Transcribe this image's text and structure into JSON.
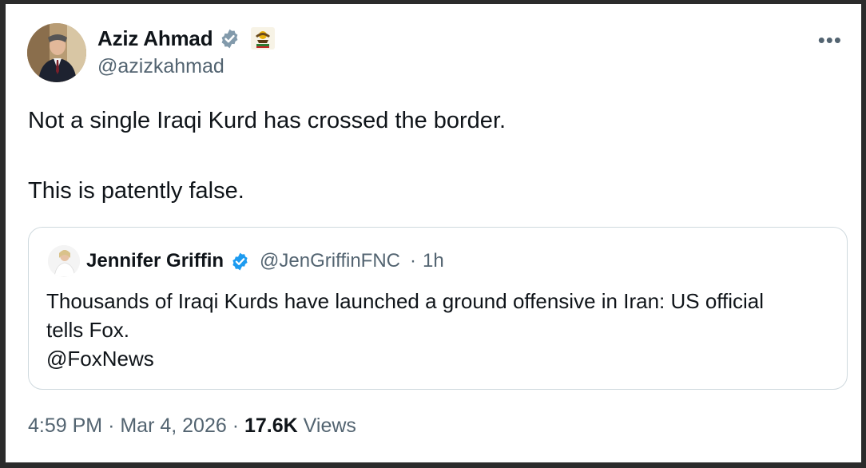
{
  "author": {
    "display_name": "Aziz Ahmad",
    "handle": "@azizkahmad",
    "verified_icon": "verified-badge-icon",
    "flag_icon": "kurdistan-emblem-icon"
  },
  "tweet": {
    "line1": "Not a single Iraqi Kurd has crossed the border.",
    "line2": "This is patently false."
  },
  "more_icon": "more-options-icon",
  "more_label": "•••",
  "quote": {
    "display_name": "Jennifer Griffin",
    "handle": "@JenGriffinFNC",
    "separator": "·",
    "time": "1h",
    "text_line1": "Thousands of Iraqi Kurds have launched a ground offensive in Iran: US official",
    "text_line2": "tells Fox.",
    "text_line3": "@FoxNews"
  },
  "footer": {
    "time": "4:59 PM",
    "sep1": "·",
    "date": "Mar 4, 2026",
    "sep2": "·",
    "views_count": "17.6K",
    "views_label": "Views"
  },
  "colors": {
    "verified": "#829aab",
    "text_primary": "#0f1419",
    "text_secondary": "#536471",
    "border": "#cfd9de"
  }
}
